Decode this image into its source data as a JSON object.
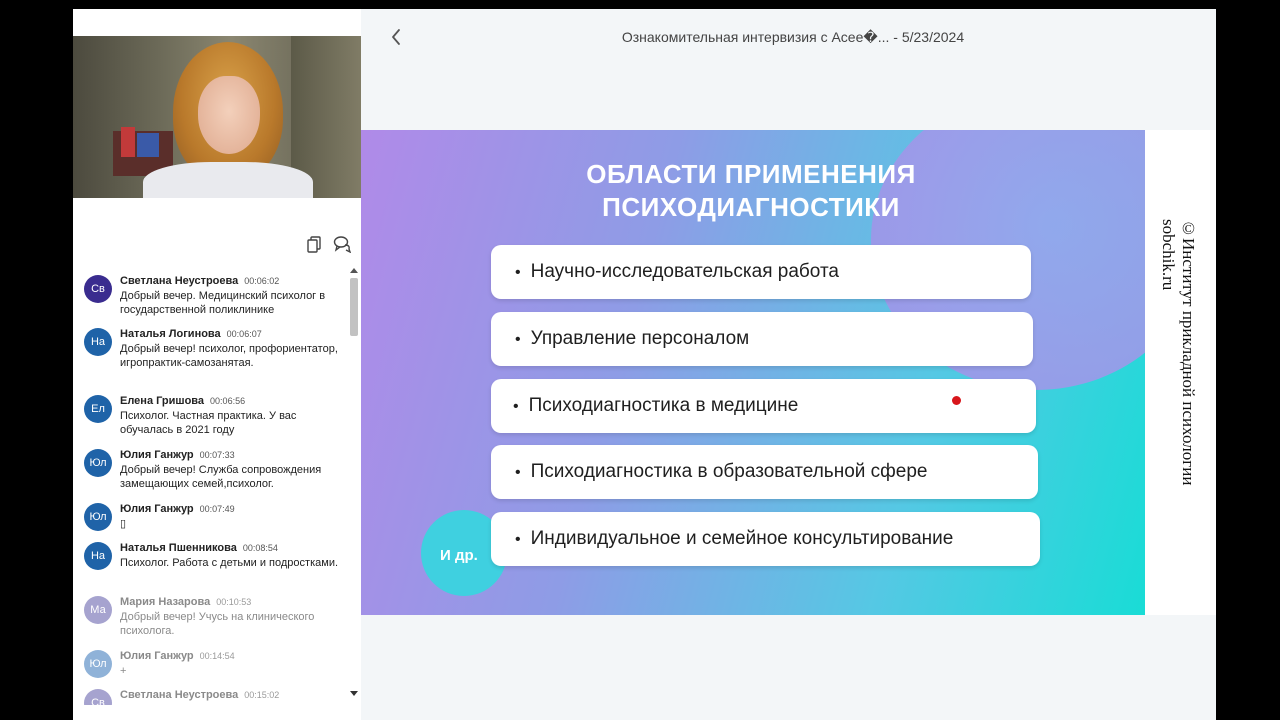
{
  "header": {
    "title": "Ознакомительная интервизия с Асее�... - 5/23/2024",
    "back_icon": "chevron-left-icon"
  },
  "toolbar": {
    "icons": [
      "copy-icon",
      "chat-bubbles-icon"
    ]
  },
  "chat": {
    "messages": [
      {
        "initials": "Св",
        "name": "Светлана Неустроева",
        "time": "00:06:02",
        "text": "Добрый вечер. Медицинский психолог в государственной поликлинике",
        "color": "#3a2c8f"
      },
      {
        "initials": "На",
        "name": "Наталья Логинова",
        "time": "00:06:07",
        "text": "Добрый вечер!  психолог, профориентатор, игропрактик-самозанятая.",
        "color": "#1f63a8"
      },
      {
        "initials": "Ел",
        "name": "Елена Гришова",
        "time": "00:06:56",
        "text": "Психолог. Частная практика. У вас обучалась в 2021 году",
        "color": "#1f63a8"
      },
      {
        "initials": "Юл",
        "name": "Юлия Ганжур",
        "time": "00:07:33",
        "text": "Добрый вечер! Служба сопровождения замещающих семей,психолог.",
        "color": "#1f63a8"
      },
      {
        "initials": "Юл",
        "name": "Юлия Ганжур",
        "time": "00:07:49",
        "text": "▯",
        "color": "#1f63a8"
      },
      {
        "initials": "На",
        "name": "Наталья Пшенникова",
        "time": "00:08:54",
        "text": "Психолог. Работа с детьми и подростками.",
        "color": "#1f63a8"
      },
      {
        "initials": "Ма",
        "name": "Мария Назарова",
        "time": "00:10:53",
        "text": "Добрый вечер! Учусь на клинического психолога.",
        "color": "#a6a3cf"
      },
      {
        "initials": "Юл",
        "name": "Юлия Ганжур",
        "time": "00:14:54",
        "text": "+",
        "color": "#8fb2d8"
      },
      {
        "initials": "Св",
        "name": "Светлана Неустроева",
        "time": "00:15:02",
        "text": "",
        "color": "#a6a3cf"
      }
    ]
  },
  "slide": {
    "title_line1": "ОБЛАСТИ ПРИМЕНЕНИЯ",
    "title_line2": "ПСИХОДИАГНОСТИКИ",
    "bullet": "•",
    "items": [
      "Научно-исследовательская работа",
      "Управление персоналом",
      "Психодиагностика в медицине",
      "Психодиагностика в образовательной сфере",
      "Индивидуальное и семейное консультирование"
    ],
    "etc": "И др."
  },
  "watermark": {
    "line1": "©Институт прикладной психологии",
    "line2": "sobchik.ru"
  }
}
